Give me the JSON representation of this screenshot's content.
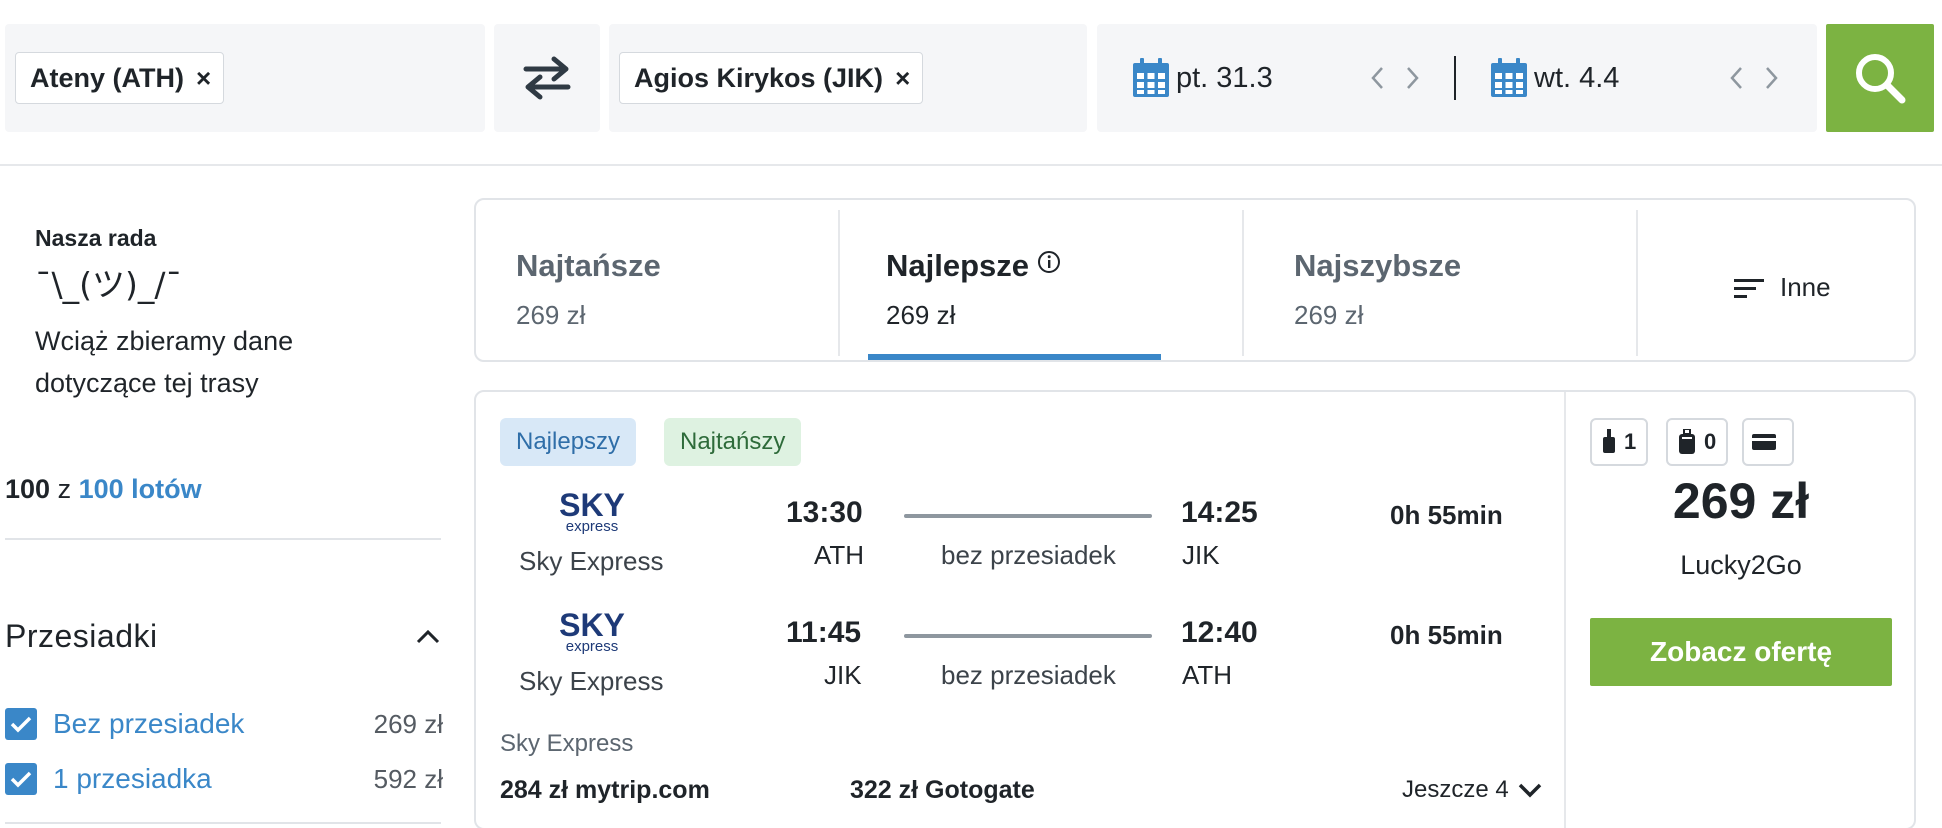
{
  "search": {
    "origin": "Ateny (ATH)",
    "destination": "Agios Kirykos (JIK)",
    "remove_symbol": "×",
    "depart_date": "pt. 31.3",
    "return_date": "wt. 4.4"
  },
  "sidebar": {
    "advice_title": "Nasza rada",
    "shrug": "¯\\_(ツ)_/¯",
    "advice_text": "Wciąż zbieramy dane dotyczące tej trasy",
    "count_shown": "100",
    "count_sep": " z ",
    "count_total": "100 lotów",
    "filter_title": "Przesiadki",
    "filters": [
      {
        "label": "Bez przesiadek",
        "price": "269 zł",
        "checked": true
      },
      {
        "label": "1 przesiadka",
        "price": "592 zł",
        "checked": true
      }
    ]
  },
  "tabs": [
    {
      "label": "Najtańsze",
      "price": "269 zł",
      "active": false
    },
    {
      "label": "Najlepsze",
      "price": "269 zł",
      "active": true
    },
    {
      "label": "Najszybsze",
      "price": "269 zł",
      "active": false
    }
  ],
  "other_label": "Inne",
  "result": {
    "badges": [
      "Najlepszy",
      "Najtańszy"
    ],
    "legs": [
      {
        "airline": "Sky Express",
        "dep_time": "13:30",
        "dep_code": "ATH",
        "arr_time": "14:25",
        "arr_code": "JIK",
        "stops": "bez przesiadek",
        "duration": "0h 55min"
      },
      {
        "airline": "Sky Express",
        "dep_time": "11:45",
        "dep_code": "JIK",
        "arr_time": "12:40",
        "arr_code": "ATH",
        "stops": "bez przesiadek",
        "duration": "0h 55min"
      }
    ],
    "logo_text_top": "SKY",
    "logo_text_bottom": "express",
    "operator": "Sky Express",
    "alt_offers": [
      "284 zł mytrip.com",
      "322 zł Gotogate"
    ],
    "more_label": "Jeszcze 4",
    "cabin_bags": "1",
    "checked_bags": "0",
    "price": "269 zł",
    "agency": "Lucky2Go",
    "cta_label": "Zobacz ofertę"
  },
  "colors": {
    "accent_blue": "#3a87c8",
    "cta_green": "#7cb342",
    "badge_best_bg": "#d8e8f7",
    "badge_cheap_bg": "#def2e1",
    "logo_navy": "#1e3a78"
  }
}
